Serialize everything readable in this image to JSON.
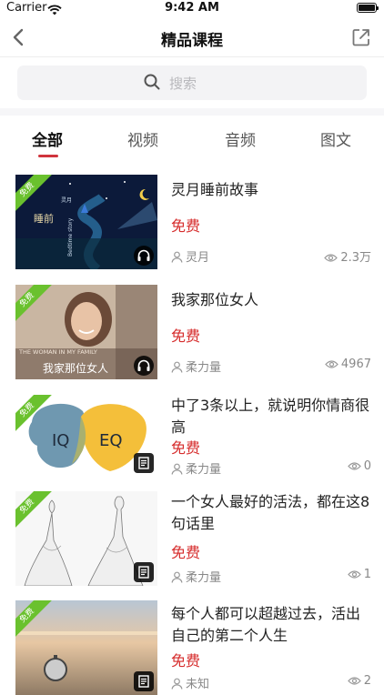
{
  "status": {
    "carrier": "Carrier",
    "time": "9:42 AM"
  },
  "nav": {
    "title": "精品课程"
  },
  "search": {
    "placeholder": "搜索"
  },
  "tabs": [
    {
      "label": "全部",
      "active": true
    },
    {
      "label": "视频",
      "active": false
    },
    {
      "label": "音频",
      "active": false
    },
    {
      "label": "图文",
      "active": false
    }
  ],
  "items": [
    {
      "title": "灵月睡前故事",
      "price": "免费",
      "author": "灵月",
      "views": "2.3万",
      "badge": "免费",
      "media": "headphones-icon",
      "thumb_text": [
        "睡前",
        "Bedtime story",
        "灵月"
      ]
    },
    {
      "title": "我家那位女人",
      "price": "免费",
      "author": "柔力量",
      "views": "4967",
      "badge": "免费",
      "media": "headphones-icon",
      "thumb_text": [
        "THE WOMAN IN MY FAMILY",
        "我家那位女人"
      ]
    },
    {
      "title": "中了3条以上，就说明你情商很高",
      "price": "免费",
      "author": "柔力量",
      "views": "0",
      "badge": "免费",
      "media": "article-icon",
      "thumb_text": [
        "IQ",
        "EQ"
      ]
    },
    {
      "title": "一个女人最好的活法，都在这8句话里",
      "price": "免费",
      "author": "柔力量",
      "views": "1",
      "badge": "免费",
      "media": "article-icon",
      "thumb_text": []
    },
    {
      "title": "每个人都可以超越过去，活出自己的第二个人生",
      "price": "免费",
      "author": "未知",
      "views": "2",
      "badge": "免费",
      "media": "article-icon",
      "thumb_text": []
    }
  ],
  "colors": {
    "accent_red": "#d62c2c",
    "tab_indicator": "#d0343d",
    "free_badge": "#6ac12e"
  }
}
